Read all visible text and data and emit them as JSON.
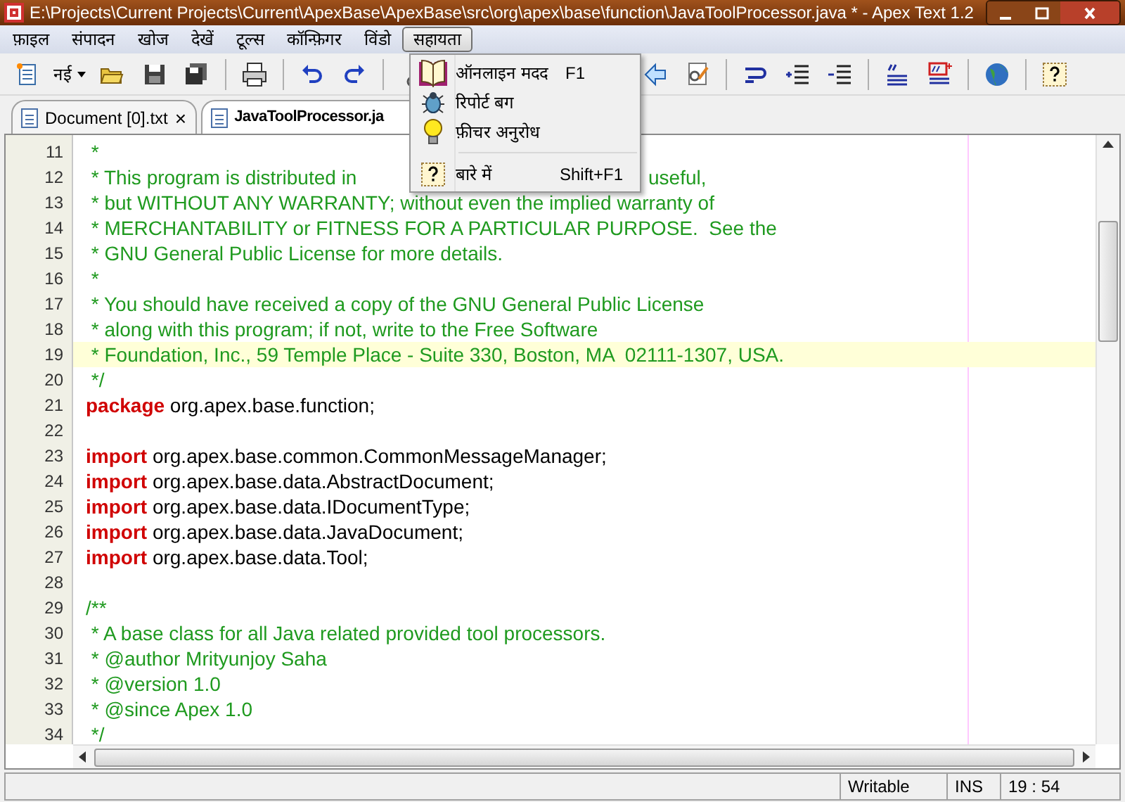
{
  "window": {
    "title": "E:\\Projects\\Current Projects\\Current\\ApexBase\\ApexBase\\src\\org\\apex\\base\\function\\JavaToolProcessor.java * - Apex Text 1.2"
  },
  "menu_bar": [
    {
      "label": "फ़ाइल",
      "selected": false
    },
    {
      "label": "संपादन",
      "selected": false
    },
    {
      "label": "खोज",
      "selected": false
    },
    {
      "label": "देखें",
      "selected": false
    },
    {
      "label": "टूल्स",
      "selected": false
    },
    {
      "label": "कॉन्फ़िगर",
      "selected": false
    },
    {
      "label": "विंडो",
      "selected": false
    },
    {
      "label": "सहायता",
      "selected": true
    }
  ],
  "toolbar": {
    "left": [
      {
        "kind": "button"
      },
      {
        "kind": "dropdown",
        "label": "नई"
      },
      {
        "kind": "button"
      },
      {
        "kind": "button"
      },
      {
        "kind": "button"
      },
      {
        "kind": "separator"
      },
      {
        "kind": "button"
      },
      {
        "kind": "separator"
      },
      {
        "kind": "button"
      },
      {
        "kind": "button"
      },
      {
        "kind": "separator"
      },
      {
        "kind": "button"
      }
    ],
    "right": [
      {
        "kind": "button"
      },
      {
        "kind": "button"
      },
      {
        "kind": "separator"
      },
      {
        "kind": "button"
      },
      {
        "kind": "button"
      },
      {
        "kind": "button"
      },
      {
        "kind": "separator"
      },
      {
        "kind": "button"
      },
      {
        "kind": "button"
      },
      {
        "kind": "separator"
      },
      {
        "kind": "button"
      },
      {
        "kind": "separator"
      },
      {
        "kind": "button"
      }
    ]
  },
  "tabs": [
    {
      "label": "Document [0].txt",
      "selected": false,
      "close": "×"
    },
    {
      "label": "JavaToolProcessor.ja",
      "selected": true
    }
  ],
  "help_menu": [
    {
      "kind": "item",
      "label": "ऑनलाइन मदद",
      "shortcut": "F1"
    },
    {
      "kind": "item",
      "label": "रिपोर्ट बग"
    },
    {
      "kind": "item",
      "label": "फ़ीचर अनुरोध"
    },
    {
      "kind": "separator"
    },
    {
      "kind": "item",
      "label": "बारे में",
      "shortcut": "Shift+F1"
    }
  ],
  "editor": {
    "lines": [
      {
        "number": "11",
        "current": false,
        "tokens": [
          {
            "kind": "comment",
            "text": " *"
          }
        ]
      },
      {
        "number": "12",
        "current": false,
        "tokens": [
          {
            "kind": "comment",
            "text": " * This program is distributed in"
          },
          {
            "kind": "comment",
            "text": "useful,",
            "after_menu": true
          }
        ]
      },
      {
        "number": "13",
        "current": false,
        "tokens": [
          {
            "kind": "comment",
            "text": " * but WITHOUT ANY WARRANTY; without even the implied warranty of"
          }
        ]
      },
      {
        "number": "14",
        "current": false,
        "tokens": [
          {
            "kind": "comment",
            "text": " * MERCHANTABILITY or FITNESS FOR A PARTICULAR PURPOSE.  See the"
          }
        ]
      },
      {
        "number": "15",
        "current": false,
        "tokens": [
          {
            "kind": "comment",
            "text": " * GNU General Public License for more details."
          }
        ]
      },
      {
        "number": "16",
        "current": false,
        "tokens": [
          {
            "kind": "comment",
            "text": " *"
          }
        ]
      },
      {
        "number": "17",
        "current": false,
        "tokens": [
          {
            "kind": "comment",
            "text": " * You should have received a copy of the GNU General Public License"
          }
        ]
      },
      {
        "number": "18",
        "current": false,
        "tokens": [
          {
            "kind": "comment",
            "text": " * along with this program; if not, write to the Free Software"
          }
        ]
      },
      {
        "number": "19",
        "current": true,
        "tokens": [
          {
            "kind": "comment",
            "text": " * Foundation, Inc., 59 Temple Place - Suite 330, Boston, MA  02111-1307, USA."
          }
        ]
      },
      {
        "number": "20",
        "current": false,
        "tokens": [
          {
            "kind": "comment",
            "text": " */"
          }
        ]
      },
      {
        "number": "21",
        "current": false,
        "tokens": [
          {
            "kind": "keyword",
            "text": "package"
          },
          {
            "kind": "plain",
            "text": " org.apex.base.function;"
          }
        ]
      },
      {
        "number": "22",
        "current": false
      },
      {
        "number": "23",
        "current": false,
        "tokens": [
          {
            "kind": "keyword",
            "text": "import"
          },
          {
            "kind": "plain",
            "text": " org.apex.base.common.CommonMessageManager;"
          }
        ]
      },
      {
        "number": "24",
        "current": false,
        "tokens": [
          {
            "kind": "keyword",
            "text": "import"
          },
          {
            "kind": "plain",
            "text": " org.apex.base.data.AbstractDocument;"
          }
        ]
      },
      {
        "number": "25",
        "current": false,
        "tokens": [
          {
            "kind": "keyword",
            "text": "import"
          },
          {
            "kind": "plain",
            "text": " org.apex.base.data.IDocumentType;"
          }
        ]
      },
      {
        "number": "26",
        "current": false,
        "tokens": [
          {
            "kind": "keyword",
            "text": "import"
          },
          {
            "kind": "plain",
            "text": " org.apex.base.data.JavaDocument;"
          }
        ]
      },
      {
        "number": "27",
        "current": false,
        "tokens": [
          {
            "kind": "keyword",
            "text": "import"
          },
          {
            "kind": "plain",
            "text": " org.apex.base.data.Tool;"
          }
        ]
      },
      {
        "number": "28",
        "current": false
      },
      {
        "number": "29",
        "current": false,
        "tokens": [
          {
            "kind": "comment",
            "text": "/**"
          }
        ]
      },
      {
        "number": "30",
        "current": false,
        "tokens": [
          {
            "kind": "comment",
            "text": " * A base class for all Java related provided tool processors."
          }
        ]
      },
      {
        "number": "31",
        "current": false,
        "tokens": [
          {
            "kind": "comment",
            "text": " * @author Mrityunjoy Saha"
          }
        ]
      },
      {
        "number": "32",
        "current": false,
        "tokens": [
          {
            "kind": "comment",
            "text": " * @version 1.0"
          }
        ]
      },
      {
        "number": "33",
        "current": false,
        "tokens": [
          {
            "kind": "comment",
            "text": " * @since Apex 1.0"
          }
        ]
      },
      {
        "number": "34",
        "current": false,
        "tokens": [
          {
            "kind": "comment",
            "text": " */"
          }
        ]
      }
    ]
  },
  "status_bar": {
    "mode": "Writable",
    "insert": "INS",
    "position": "19 : 54"
  }
}
